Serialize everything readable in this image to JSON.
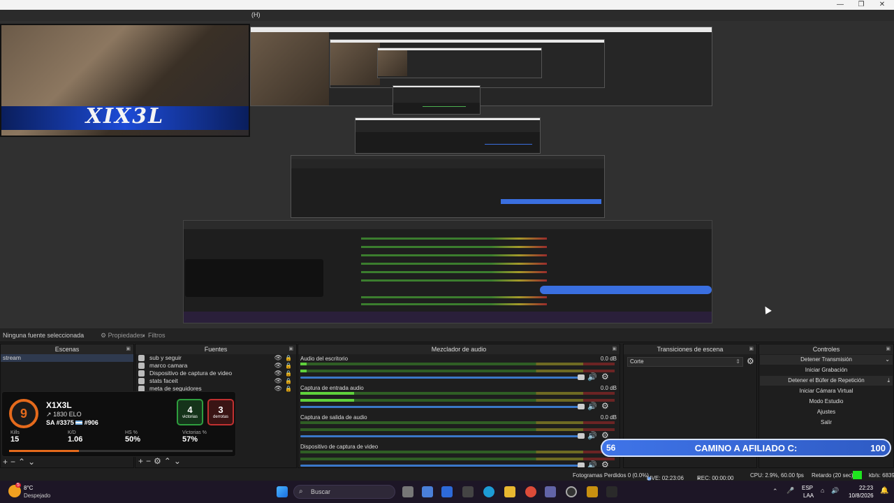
{
  "window": {
    "menu_fragment": "(H)",
    "minimize": "—",
    "maximize": "❐",
    "close": "✕"
  },
  "webcam": {
    "overlay_name": "XIX3L"
  },
  "sources_toolbar": {
    "no_selection": "Ninguna fuente seleccionada",
    "properties": "Propiedades",
    "filters": "Filtros"
  },
  "scenes": {
    "title": "Escenas",
    "items": [
      "stream"
    ]
  },
  "sources": {
    "title": "Fuentes",
    "items": [
      "sub y seguir",
      "marco camara",
      "Dispositivo de captura de video",
      "stats faceit",
      "meta de seguidores"
    ]
  },
  "stats_card": {
    "level": "9",
    "name": "X1X3L",
    "elo": "1830 ELO",
    "rank": "SA #3375",
    "country_rank": "#906",
    "wins": "4",
    "wins_label": "victorias",
    "losses": "3",
    "losses_label": "derrotas",
    "kills_label": "Kills",
    "kills": "15",
    "kd_label": "K/D",
    "kd": "1.06",
    "hs_label": "HS %",
    "hs": "50%",
    "winrate_label": "Victorias %",
    "winrate": "57%"
  },
  "mixer": {
    "title": "Mezclador de audio",
    "tracks": [
      {
        "name": "Audio del escritorio",
        "db": "0.0 dB",
        "level": 0.02
      },
      {
        "name": "Captura de entrada audio",
        "db": "0.0 dB",
        "level": 0.17
      },
      {
        "name": "Captura de salida de audio",
        "db": "0.0 dB",
        "level": 0.0
      },
      {
        "name": "Dispositivo de captura de video",
        "db": "0.0 dB",
        "level": 0.0
      }
    ]
  },
  "transitions": {
    "title": "Transiciones de escena",
    "selected": "Corte"
  },
  "controls": {
    "title": "Controles",
    "buttons": [
      "Detener Transmisión",
      "Iniciar Grabación",
      "Detener el Búfer de Repetición",
      "Iniciar Cámara Virtual",
      "Modo Estudio",
      "Ajustes",
      "Salir"
    ]
  },
  "banner": {
    "current": "56",
    "label": "CAMINO A AFILIADO C:",
    "goal": "100"
  },
  "statusbar": {
    "dropped": "Fotogramas Perdidos 0 (0.0%)",
    "live": "LIVE: 02:23:06",
    "rec": "REC: 00:00:00",
    "cpu": "CPU: 2.9%, 60.00 fps",
    "delay": "Retardo (20 sec)",
    "kbps": "kb/s: 6839"
  },
  "taskbar": {
    "temperature": "8°C",
    "weather": "Despejado",
    "weather_badge": "5",
    "search": "Buscar",
    "lang": "ESP",
    "layout": "LAA",
    "time": "22:23",
    "date": "10/8/2026"
  },
  "colors": {
    "accent_blue": "#3a78c8",
    "faceit_orange": "#e56a1c",
    "win_green": "#2e9e3e",
    "loss_red": "#c03030",
    "banner_blue": "#3f74e8"
  }
}
